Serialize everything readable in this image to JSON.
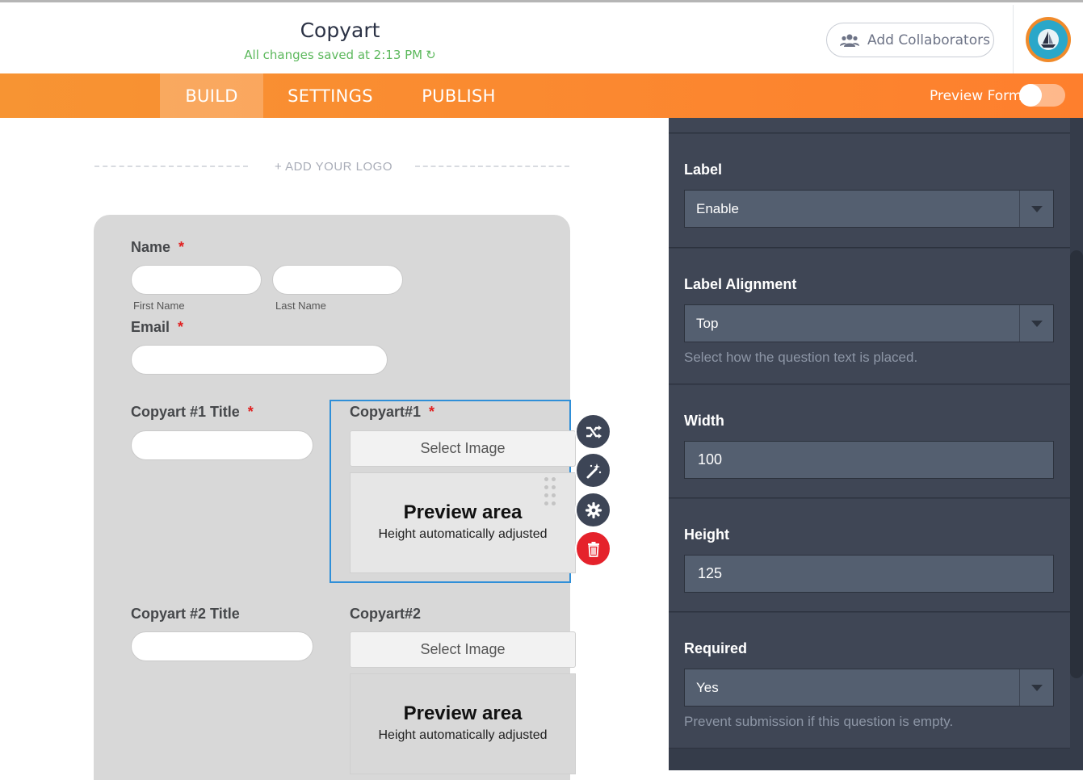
{
  "header": {
    "form_title": "Copyart",
    "saved_status": "All changes saved at 2:13 PM",
    "collaborators_button": "Add Collaborators"
  },
  "nav": {
    "tabs": [
      {
        "label": "BUILD",
        "active": true
      },
      {
        "label": "SETTINGS",
        "active": false
      },
      {
        "label": "PUBLISH",
        "active": false
      }
    ],
    "preview_label": "Preview Form",
    "preview_enabled": false
  },
  "canvas": {
    "logo_text": "+ ADD YOUR LOGO",
    "fields": {
      "name_label": "Name",
      "name_required": "*",
      "first_name": "First Name",
      "last_name": "Last Name",
      "email_label": "Email",
      "email_required": "*",
      "copyart1_title_label": "Copyart #1 Title",
      "copyart1_title_required": "*",
      "copyart1_label": "Copyart#1",
      "copyart1_required": "*",
      "select_image_1": "Select Image",
      "preview_title_1": "Preview area",
      "preview_sub_1": "Height automatically adjusted",
      "copyart2_title_label": "Copyart #2 Title",
      "copyart2_label": "Copyart#2",
      "select_image_2": "Select Image",
      "preview_title_2": "Preview area",
      "preview_sub_2": "Height automatically adjusted"
    },
    "tools": [
      "shuffle-icon",
      "magic-wand-icon",
      "gear-icon",
      "trash-icon"
    ]
  },
  "panel": {
    "label": {
      "title": "Label",
      "value": "Enable"
    },
    "label_alignment": {
      "title": "Label Alignment",
      "value": "Top",
      "help": "Select how the question text is placed."
    },
    "width": {
      "title": "Width",
      "value": "100"
    },
    "height": {
      "title": "Height",
      "value": "125"
    },
    "required": {
      "title": "Required",
      "value": "Yes",
      "help": "Prevent submission if this question is empty."
    }
  },
  "colors": {
    "nav_orange": "#fe7f2d",
    "saved_green": "#5cb85c",
    "selection_blue": "#2f8fd8",
    "delete_red": "#e5222b",
    "panel_bg": "#3f4655"
  }
}
